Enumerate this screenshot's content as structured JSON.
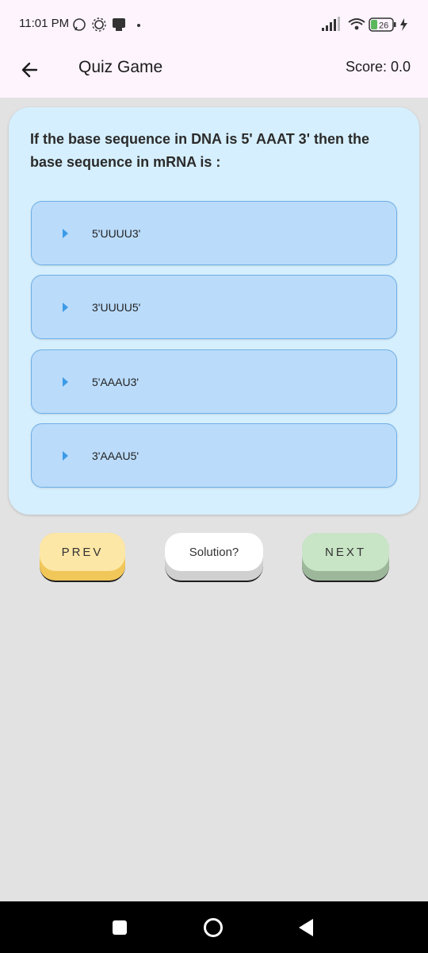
{
  "status_bar": {
    "time": "11:01 PM",
    "battery": "26",
    "icons": [
      "whatsapp-icon",
      "settings-gear-icon",
      "notification-icon",
      "dot-icon",
      "signal-icon",
      "wifi-icon",
      "battery-icon",
      "charging-icon"
    ]
  },
  "app_bar": {
    "title": "Quiz Game",
    "score": "Score: 0.0"
  },
  "question": {
    "text": "If the base sequence in DNA is 5' AAAT 3' then the base sequence in mRNA is :",
    "options": [
      {
        "label": "5'UUUU3'"
      },
      {
        "label": "3'UUUU5'"
      },
      {
        "label": "5'AAAU3'"
      },
      {
        "label": "3'AAAU5'"
      }
    ]
  },
  "buttons": {
    "prev": "PREV",
    "solution": "Solution?",
    "next": "NEXT"
  },
  "colors": {
    "card_bg": "#d6effe",
    "option_bg": "#badbfa",
    "option_border": "#6fb0e6",
    "prev_bg": "#fde7a6",
    "next_bg": "#c8e5c6"
  }
}
